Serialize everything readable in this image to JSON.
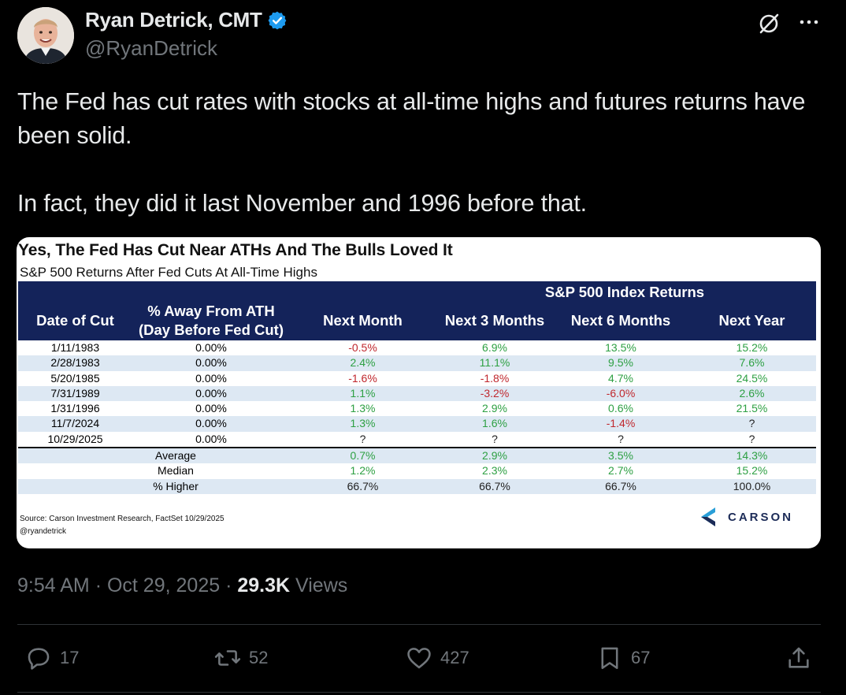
{
  "author": {
    "display_name": "Ryan Detrick, CMT",
    "handle": "@RyanDetrick"
  },
  "tweet": {
    "paragraph_1": "The Fed has cut rates with stocks at all-time highs and futures returns have been solid.",
    "paragraph_2": "In fact, they did it last November and 1996 before that."
  },
  "image": {
    "title": "Yes, The Fed Has Cut Near ATHs And The Bulls Loved It",
    "subtitle": "S&P 500 Returns After Fed Cuts At All-Time Highs",
    "headers": {
      "group": "S&P 500 Index Returns",
      "date": "Date of Cut",
      "away_line1": "% Away From ATH",
      "away_line2": "(Day Before Fed Cut)",
      "m1": "Next Month",
      "m3": "Next 3 Months",
      "m6": "Next 6 Months",
      "y1": "Next Year"
    },
    "rows": [
      {
        "date": "1/11/1983",
        "away": "0.00%",
        "m1": "-0.5%",
        "m3": "6.9%",
        "m6": "13.5%",
        "y1": "15.2%"
      },
      {
        "date": "2/28/1983",
        "away": "0.00%",
        "m1": "2.4%",
        "m3": "11.1%",
        "m6": "9.5%",
        "y1": "7.6%"
      },
      {
        "date": "5/20/1985",
        "away": "0.00%",
        "m1": "-1.6%",
        "m3": "-1.8%",
        "m6": "4.7%",
        "y1": "24.5%"
      },
      {
        "date": "7/31/1989",
        "away": "0.00%",
        "m1": "1.1%",
        "m3": "-3.2%",
        "m6": "-6.0%",
        "y1": "2.6%"
      },
      {
        "date": "1/31/1996",
        "away": "0.00%",
        "m1": "1.3%",
        "m3": "2.9%",
        "m6": "0.6%",
        "y1": "21.5%"
      },
      {
        "date": "11/7/2024",
        "away": "0.00%",
        "m1": "1.3%",
        "m3": "1.6%",
        "m6": "-1.4%",
        "y1": "?"
      },
      {
        "date": "10/29/2025",
        "away": "0.00%",
        "m1": "?",
        "m3": "?",
        "m6": "?",
        "y1": "?"
      }
    ],
    "summary": [
      {
        "label": "Average",
        "m1": "0.7%",
        "m3": "2.9%",
        "m6": "3.5%",
        "y1": "14.3%"
      },
      {
        "label": "Median",
        "m1": "1.2%",
        "m3": "2.3%",
        "m6": "2.7%",
        "y1": "15.2%"
      },
      {
        "label": "% Higher",
        "m1": "66.7%",
        "m3": "66.7%",
        "m6": "66.7%",
        "y1": "100.0%"
      }
    ],
    "source": "Source: Carson Investment Research, FactSet 10/29/2025",
    "credit": "@ryandetrick",
    "logo_text": "CARSON",
    "colors": {
      "header_bg": "#14235a",
      "positive": "#2ea043",
      "negative": "#c0272d",
      "row_shade": "#dde8f3"
    }
  },
  "meta": {
    "time": "9:54 AM",
    "date": "Oct 29, 2025",
    "views_count": "29.3K",
    "views_label": "Views"
  },
  "actions": {
    "replies": "17",
    "reposts": "52",
    "likes": "427",
    "bookmarks": "67"
  },
  "icons": [
    "verified-badge-icon",
    "grok-icon",
    "more-icon",
    "reply-icon",
    "repost-icon",
    "like-icon",
    "bookmark-icon",
    "share-icon"
  ]
}
